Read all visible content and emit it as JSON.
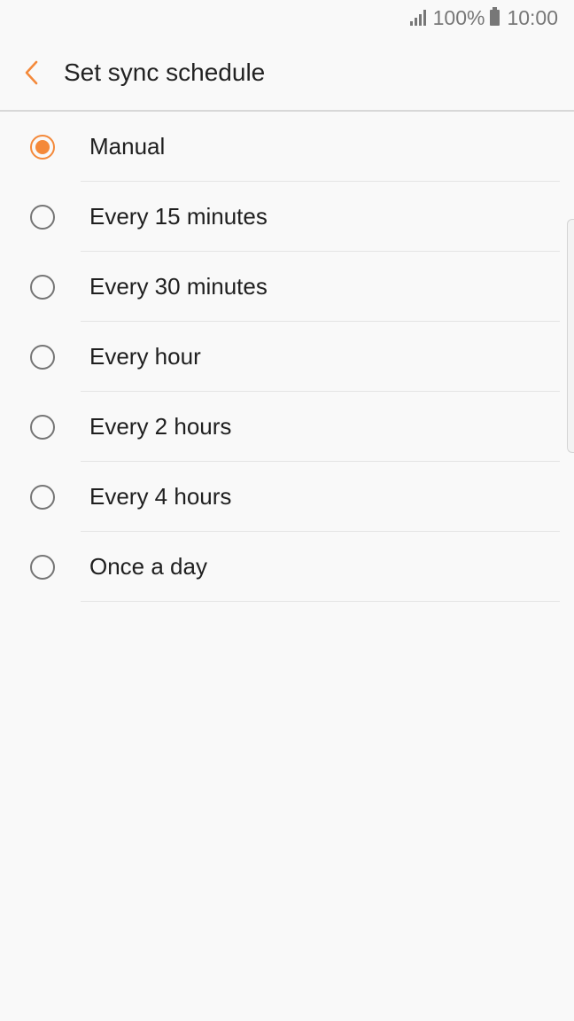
{
  "status_bar": {
    "battery": "100%",
    "time": "10:00",
    "icons": [
      "signal-icon",
      "battery-icon"
    ]
  },
  "header": {
    "title": "Set sync schedule",
    "back_icon": "chevron-left-icon"
  },
  "options": [
    {
      "label": "Manual",
      "selected": true
    },
    {
      "label": "Every 15 minutes",
      "selected": false
    },
    {
      "label": "Every 30 minutes",
      "selected": false
    },
    {
      "label": "Every hour",
      "selected": false
    },
    {
      "label": "Every 2 hours",
      "selected": false
    },
    {
      "label": "Every 4 hours",
      "selected": false
    },
    {
      "label": "Once a day",
      "selected": false
    }
  ],
  "colors": {
    "accent": "#f4893a",
    "background": "#f9f9f9",
    "text": "#1f1f1f"
  }
}
